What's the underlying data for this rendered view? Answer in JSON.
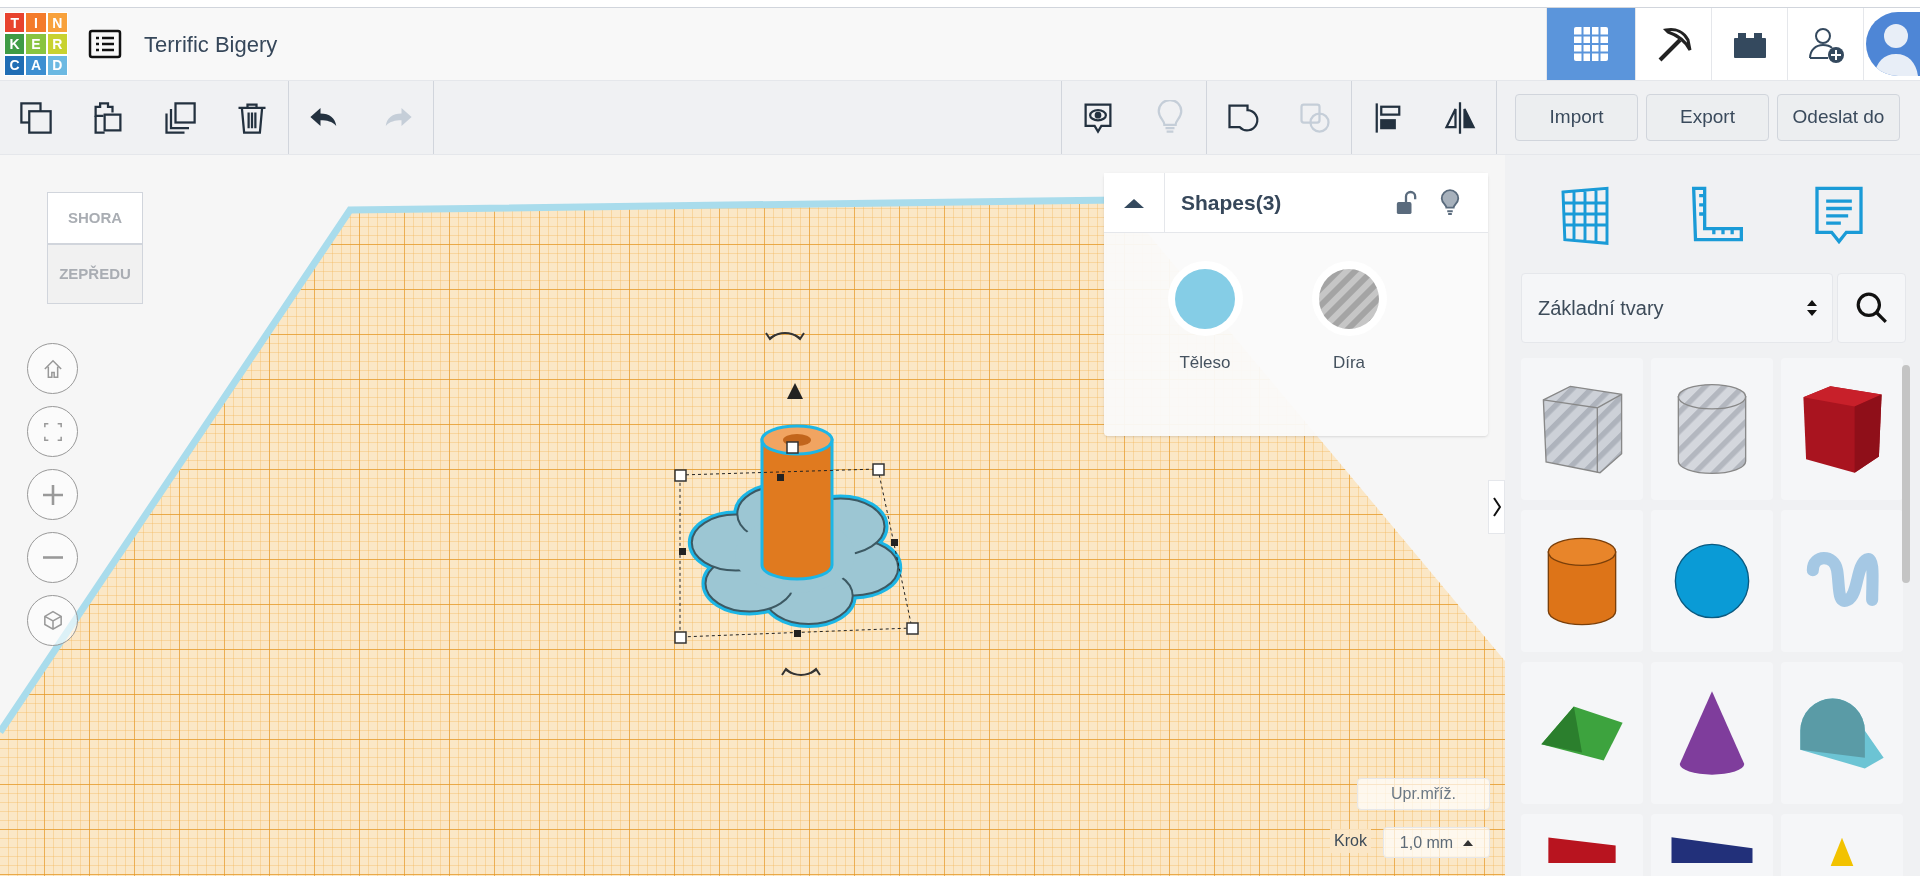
{
  "header": {
    "logo": [
      {
        "letter": "T",
        "color": "#e8432e"
      },
      {
        "letter": "I",
        "color": "#f47b2b"
      },
      {
        "letter": "N",
        "color": "#f8a13b"
      },
      {
        "letter": "K",
        "color": "#3f9b45"
      },
      {
        "letter": "E",
        "color": "#89c440"
      },
      {
        "letter": "R",
        "color": "#c8d230"
      },
      {
        "letter": "C",
        "color": "#1f6db4"
      },
      {
        "letter": "A",
        "color": "#3d8fd1"
      },
      {
        "letter": "D",
        "color": "#6cb9e2"
      }
    ],
    "title": "Terrific Bigery",
    "view_modes": [
      {
        "kind": "grid",
        "selected": true
      },
      {
        "kind": "pickaxe",
        "selected": false
      },
      {
        "kind": "brick",
        "selected": false
      }
    ],
    "account": [
      {
        "kind": "add-user"
      },
      {
        "kind": "avatar"
      }
    ]
  },
  "toolbar": {
    "groups": [
      [
        {
          "kind": "copy",
          "disabled": false
        },
        {
          "kind": "paste",
          "disabled": false
        },
        {
          "kind": "duplicate",
          "disabled": false
        },
        {
          "kind": "delete",
          "disabled": false
        }
      ],
      [
        {
          "kind": "undo",
          "disabled": false
        },
        {
          "kind": "redo",
          "disabled": true
        }
      ],
      [
        {
          "kind": "note",
          "disabled": false
        },
        {
          "kind": "bulb",
          "disabled": true
        }
      ],
      [
        {
          "kind": "group",
          "disabled": false
        },
        {
          "kind": "ungroup",
          "disabled": true
        }
      ],
      [
        {
          "kind": "align",
          "disabled": false
        },
        {
          "kind": "mirror",
          "disabled": false
        }
      ]
    ],
    "buttons": [
      "Import",
      "Export",
      "Odeslat do"
    ]
  },
  "view_cube": {
    "top": "SHORA",
    "front": "ZEPŘEDU"
  },
  "nav_controls": [
    {
      "kind": "home"
    },
    {
      "kind": "fit"
    },
    {
      "kind": "zoom-in"
    },
    {
      "kind": "zoom-out"
    },
    {
      "kind": "perspective"
    }
  ],
  "shapes_panel": {
    "title": "Shapes(3)",
    "locked": false,
    "options": [
      {
        "kind": "solid",
        "label": "Těleso"
      },
      {
        "kind": "hole",
        "label": "Díra"
      }
    ]
  },
  "grid_controls": {
    "edit_grid": "Upr.mříž.",
    "snap_label": "Krok",
    "snap_value": "1,0 mm"
  },
  "library": {
    "tabs": [
      {
        "kind": "workplane"
      },
      {
        "kind": "ruler"
      },
      {
        "kind": "notes"
      }
    ],
    "category": "Základní tvary",
    "shapes": [
      {
        "kind": "box-hole"
      },
      {
        "kind": "cylinder-hole"
      },
      {
        "kind": "box"
      },
      {
        "kind": "cylinder"
      },
      {
        "kind": "sphere"
      },
      {
        "kind": "scribble"
      },
      {
        "kind": "roof"
      },
      {
        "kind": "cone"
      },
      {
        "kind": "round-roof"
      },
      {
        "kind": "brick"
      },
      {
        "kind": "wedge"
      },
      {
        "kind": "pyramid"
      }
    ]
  }
}
